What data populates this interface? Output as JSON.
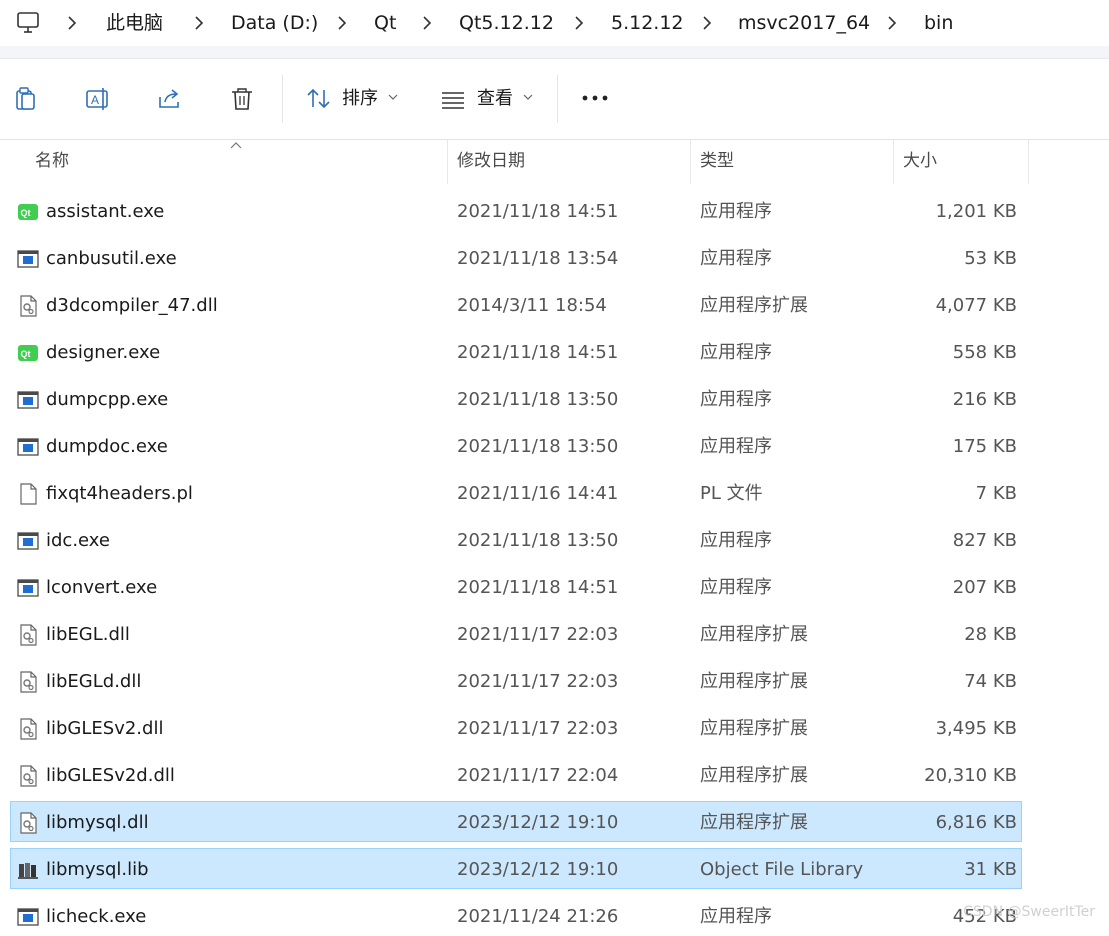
{
  "breadcrumb": [
    "此电脑",
    "Data (D:)",
    "Qt",
    "Qt5.12.12",
    "5.12.12",
    "msvc2017_64",
    "bin"
  ],
  "toolbar": {
    "sort_label": "排序",
    "view_label": "查看",
    "icons": [
      "copy-icon",
      "rename-icon",
      "share-icon",
      "delete-icon",
      "sort-icon",
      "view-icon",
      "more-icon"
    ]
  },
  "columns": {
    "name": "名称",
    "date": "修改日期",
    "type": "类型",
    "size": "大小"
  },
  "files": [
    {
      "name": "assistant.exe",
      "date": "2021/11/18 14:51",
      "type": "应用程序",
      "size": "1,201 KB",
      "icon": "qt-app-icon"
    },
    {
      "name": "canbusutil.exe",
      "date": "2021/11/18 13:54",
      "type": "应用程序",
      "size": "53 KB",
      "icon": "exe-icon"
    },
    {
      "name": "d3dcompiler_47.dll",
      "date": "2014/3/11 18:54",
      "type": "应用程序扩展",
      "size": "4,077 KB",
      "icon": "dll-icon"
    },
    {
      "name": "designer.exe",
      "date": "2021/11/18 14:51",
      "type": "应用程序",
      "size": "558 KB",
      "icon": "qt-app-icon"
    },
    {
      "name": "dumpcpp.exe",
      "date": "2021/11/18 13:50",
      "type": "应用程序",
      "size": "216 KB",
      "icon": "exe-icon"
    },
    {
      "name": "dumpdoc.exe",
      "date": "2021/11/18 13:50",
      "type": "应用程序",
      "size": "175 KB",
      "icon": "exe-icon"
    },
    {
      "name": "fixqt4headers.pl",
      "date": "2021/11/16 14:41",
      "type": "PL 文件",
      "size": "7 KB",
      "icon": "file-icon"
    },
    {
      "name": "idc.exe",
      "date": "2021/11/18 13:50",
      "type": "应用程序",
      "size": "827 KB",
      "icon": "exe-icon"
    },
    {
      "name": "lconvert.exe",
      "date": "2021/11/18 14:51",
      "type": "应用程序",
      "size": "207 KB",
      "icon": "exe-icon"
    },
    {
      "name": "libEGL.dll",
      "date": "2021/11/17 22:03",
      "type": "应用程序扩展",
      "size": "28 KB",
      "icon": "dll-icon"
    },
    {
      "name": "libEGLd.dll",
      "date": "2021/11/17 22:03",
      "type": "应用程序扩展",
      "size": "74 KB",
      "icon": "dll-icon"
    },
    {
      "name": "libGLESv2.dll",
      "date": "2021/11/17 22:03",
      "type": "应用程序扩展",
      "size": "3,495 KB",
      "icon": "dll-icon"
    },
    {
      "name": "libGLESv2d.dll",
      "date": "2021/11/17 22:04",
      "type": "应用程序扩展",
      "size": "20,310 KB",
      "icon": "dll-icon"
    },
    {
      "name": "libmysql.dll",
      "date": "2023/12/12 19:10",
      "type": "应用程序扩展",
      "size": "6,816 KB",
      "icon": "dll-icon",
      "selected": true
    },
    {
      "name": "libmysql.lib",
      "date": "2023/12/12 19:10",
      "type": "Object File Library",
      "size": "31 KB",
      "icon": "lib-icon",
      "selected": true
    },
    {
      "name": "licheck.exe",
      "date": "2021/11/24 21:26",
      "type": "应用程序",
      "size": "452 KB",
      "icon": "exe-icon"
    }
  ],
  "watermark": "CSDN @SweerItTer",
  "colors": {
    "selection": "#cce8ff",
    "selection_border": "#99d1ff",
    "qt_green": "#41cd52",
    "exe_blue": "#1f6fd0"
  }
}
